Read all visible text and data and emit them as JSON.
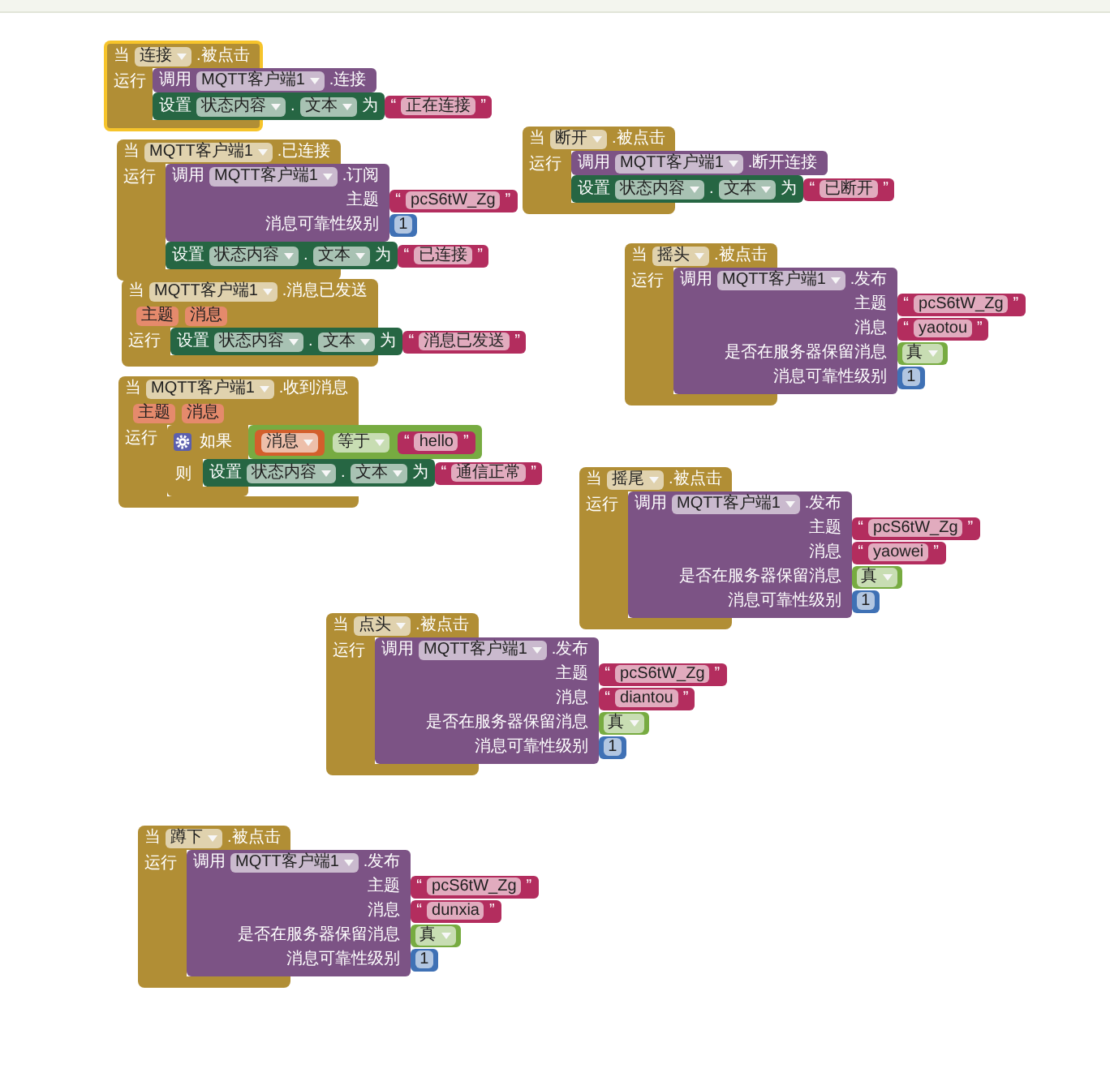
{
  "blocks": [
    {
      "kind": "event",
      "selected": true,
      "when": "当",
      "component": "连接",
      "event": ".被点击",
      "do": "运行",
      "statements": [
        {
          "kind": "call",
          "call": "调用",
          "component": "MQTT客户端1",
          "method": ".连接"
        },
        {
          "kind": "set",
          "set": "设置",
          "component": "状态内容",
          "dot": ".",
          "property": "文本",
          "to": "为",
          "value": {
            "kind": "text",
            "open": "“",
            "text": "正在连接",
            "close": "”"
          }
        }
      ]
    },
    {
      "kind": "event",
      "selected": false,
      "when": "当",
      "component": "MQTT客户端1",
      "event": ".已连接",
      "do": "运行",
      "statements": [
        {
          "kind": "call",
          "call": "调用",
          "component": "MQTT客户端1",
          "method": ".订阅",
          "args": [
            {
              "label": "主题",
              "value": {
                "kind": "text",
                "open": "“",
                "text": "pcS6tW_Zg",
                "close": "”"
              }
            },
            {
              "label": "消息可靠性级别",
              "value": {
                "kind": "number",
                "text": "1"
              }
            }
          ]
        },
        {
          "kind": "set",
          "set": "设置",
          "component": "状态内容",
          "dot": ".",
          "property": "文本",
          "to": "为",
          "value": {
            "kind": "text",
            "open": "“",
            "text": "已连接",
            "close": "”"
          }
        }
      ]
    },
    {
      "kind": "event",
      "selected": false,
      "when": "当",
      "component": "MQTT客户端1",
      "event": ".消息已发送",
      "params": [
        "主题",
        "消息"
      ],
      "do": "运行",
      "statements": [
        {
          "kind": "set",
          "set": "设置",
          "component": "状态内容",
          "dot": ".",
          "property": "文本",
          "to": "为",
          "value": {
            "kind": "text",
            "open": "“",
            "text": "消息已发送",
            "close": "”"
          }
        }
      ]
    },
    {
      "kind": "event",
      "selected": false,
      "when": "当",
      "component": "MQTT客户端1",
      "event": ".收到消息",
      "params": [
        "主题",
        "消息"
      ],
      "do": "运行",
      "statements": [
        {
          "kind": "if",
          "if": "如果",
          "condition": {
            "kind": "compare",
            "left": {
              "kind": "get",
              "text": "消息"
            },
            "op": "等于",
            "right": {
              "kind": "text",
              "open": "“",
              "text": "hello",
              "close": "”"
            }
          },
          "then": "则",
          "statements": [
            {
              "kind": "set",
              "set": "设置",
              "component": "状态内容",
              "dot": ".",
              "property": "文本",
              "to": "为",
              "value": {
                "kind": "text",
                "open": "“",
                "text": "通信正常",
                "close": "”"
              }
            }
          ]
        }
      ]
    },
    {
      "kind": "event",
      "selected": false,
      "when": "当",
      "component": "断开",
      "event": ".被点击",
      "do": "运行",
      "statements": [
        {
          "kind": "call",
          "call": "调用",
          "component": "MQTT客户端1",
          "method": ".断开连接"
        },
        {
          "kind": "set",
          "set": "设置",
          "component": "状态内容",
          "dot": ".",
          "property": "文本",
          "to": "为",
          "value": {
            "kind": "text",
            "open": "“",
            "text": "已断开",
            "close": "”"
          }
        }
      ]
    },
    {
      "kind": "event",
      "selected": false,
      "when": "当",
      "component": "摇头",
      "event": ".被点击",
      "do": "运行",
      "statements": [
        {
          "kind": "call",
          "call": "调用",
          "component": "MQTT客户端1",
          "method": ".发布",
          "args": [
            {
              "label": "主题",
              "value": {
                "kind": "text",
                "open": "“",
                "text": "pcS6tW_Zg",
                "close": "”"
              }
            },
            {
              "label": "消息",
              "value": {
                "kind": "text",
                "open": "“",
                "text": "yaotou",
                "close": "”"
              }
            },
            {
              "label": "是否在服务器保留消息",
              "value": {
                "kind": "bool",
                "text": "真"
              }
            },
            {
              "label": "消息可靠性级别",
              "value": {
                "kind": "number",
                "text": "1"
              }
            }
          ]
        }
      ]
    },
    {
      "kind": "event",
      "selected": false,
      "when": "当",
      "component": "摇尾",
      "event": ".被点击",
      "do": "运行",
      "statements": [
        {
          "kind": "call",
          "call": "调用",
          "component": "MQTT客户端1",
          "method": ".发布",
          "args": [
            {
              "label": "主题",
              "value": {
                "kind": "text",
                "open": "“",
                "text": "pcS6tW_Zg",
                "close": "”"
              }
            },
            {
              "label": "消息",
              "value": {
                "kind": "text",
                "open": "“",
                "text": "yaowei",
                "close": "”"
              }
            },
            {
              "label": "是否在服务器保留消息",
              "value": {
                "kind": "bool",
                "text": "真"
              }
            },
            {
              "label": "消息可靠性级别",
              "value": {
                "kind": "number",
                "text": "1"
              }
            }
          ]
        }
      ]
    },
    {
      "kind": "event",
      "selected": false,
      "when": "当",
      "component": "点头",
      "event": ".被点击",
      "do": "运行",
      "statements": [
        {
          "kind": "call",
          "call": "调用",
          "component": "MQTT客户端1",
          "method": ".发布",
          "args": [
            {
              "label": "主题",
              "value": {
                "kind": "text",
                "open": "“",
                "text": "pcS6tW_Zg",
                "close": "”"
              }
            },
            {
              "label": "消息",
              "value": {
                "kind": "text",
                "open": "“",
                "text": "diantou",
                "close": "”"
              }
            },
            {
              "label": "是否在服务器保留消息",
              "value": {
                "kind": "bool",
                "text": "真"
              }
            },
            {
              "label": "消息可靠性级别",
              "value": {
                "kind": "number",
                "text": "1"
              }
            }
          ]
        }
      ]
    },
    {
      "kind": "event",
      "selected": false,
      "when": "当",
      "component": "蹲下",
      "event": ".被点击",
      "do": "运行",
      "statements": [
        {
          "kind": "call",
          "call": "调用",
          "component": "MQTT客户端1",
          "method": ".发布",
          "args": [
            {
              "label": "主题",
              "value": {
                "kind": "text",
                "open": "“",
                "text": "pcS6tW_Zg",
                "close": "”"
              }
            },
            {
              "label": "消息",
              "value": {
                "kind": "text",
                "open": "“",
                "text": "dunxia",
                "close": "”"
              }
            },
            {
              "label": "是否在服务器保留消息",
              "value": {
                "kind": "bool",
                "text": "真"
              }
            },
            {
              "label": "消息可靠性级别",
              "value": {
                "kind": "number",
                "text": "1"
              }
            }
          ]
        }
      ]
    }
  ]
}
